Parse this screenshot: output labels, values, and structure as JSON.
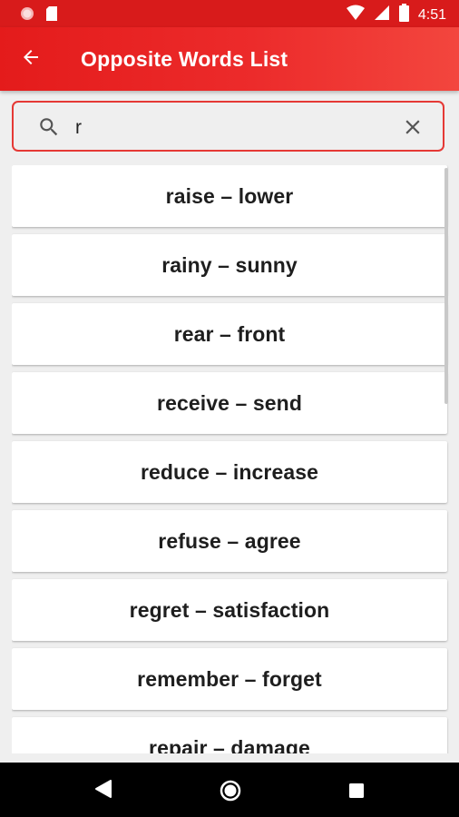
{
  "status_bar": {
    "time": "4:51",
    "icons": [
      "record-icon",
      "sd-card-icon",
      "wifi-icon",
      "signal-icon",
      "battery-icon"
    ]
  },
  "app_bar": {
    "title": "Opposite Words List",
    "back_icon": "arrow-left-icon"
  },
  "search": {
    "value": "r",
    "placeholder": "",
    "search_icon": "search-icon",
    "clear_icon": "close-icon"
  },
  "list": {
    "items": [
      "raise – lower",
      "rainy – sunny",
      "rear – front",
      "receive – send",
      "reduce – increase",
      "refuse – agree",
      "regret – satisfaction",
      "remember – forget",
      "repair – damage"
    ]
  },
  "nav_bar": {
    "icons": [
      "back-triangle-icon",
      "home-circle-icon",
      "recents-square-icon"
    ]
  },
  "colors": {
    "accent": "#e41b1b",
    "status_bar": "#d81b1b",
    "search_border": "#e53935",
    "background": "#efefef"
  }
}
